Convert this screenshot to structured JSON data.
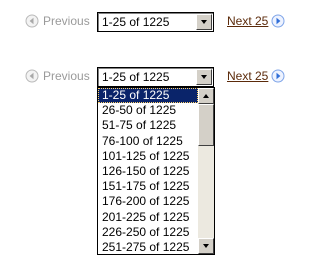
{
  "pagers": [
    {
      "previous_label": "Previous",
      "selected_range": "1-25 of 1225",
      "next_label": "Next 25"
    },
    {
      "previous_label": "Previous",
      "selected_range": "1-25 of 1225",
      "next_label": "Next 25"
    }
  ],
  "dropdown": {
    "selected_index": 0,
    "options": [
      "1-25 of 1225",
      "26-50 of 1225",
      "51-75 of 1225",
      "76-100 of 1225",
      "101-125 of 1225",
      "126-150 of 1225",
      "151-175 of 1225",
      "176-200 of 1225",
      "201-225 of 1225",
      "226-250 of 1225",
      "251-275 of 1225"
    ]
  },
  "icons": {
    "previous": "circle-left-arrow-icon",
    "next": "circle-right-arrow-icon",
    "dropdown_button": "chevron-down-icon",
    "scroll_up": "chevron-up-icon",
    "scroll_down": "chevron-down-icon"
  },
  "colors": {
    "disabled_text": "#9a9a9a",
    "link_text": "#5b2a0a",
    "selection_background": "#0a246a",
    "selection_text": "#ffffff",
    "next_icon_blue": "#2f6ed8"
  }
}
